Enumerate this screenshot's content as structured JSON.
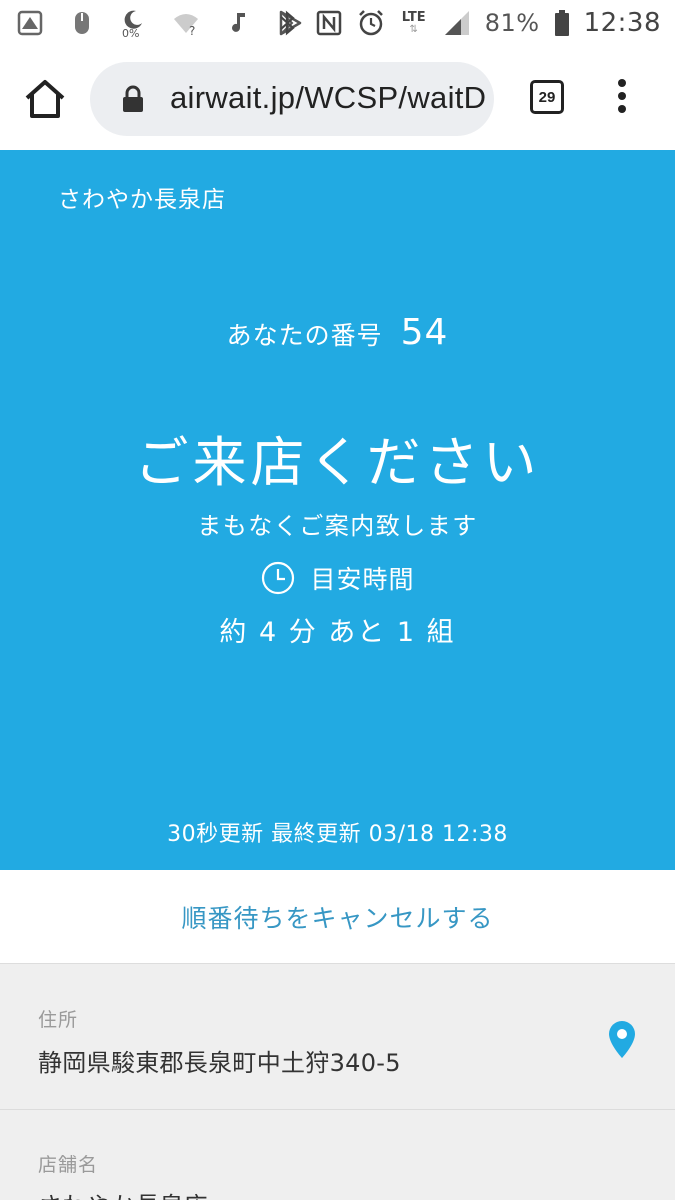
{
  "status_bar": {
    "icons_left": [
      "gallery-icon",
      "mouse-icon",
      "moon-icon",
      "wifi-question-icon",
      "music-note-icon",
      "play-store-icon"
    ],
    "data_saver_label": "0%",
    "icons_right": [
      "bluetooth-icon",
      "nfc-icon",
      "alarm-icon",
      "lte-icon",
      "signal-icon",
      "battery-icon"
    ],
    "lte_label": "LTE",
    "battery_percent": "81%",
    "time": "12:38"
  },
  "browser": {
    "url": "airwait.jp/WCSP/waitD",
    "tab_count": "29"
  },
  "hero": {
    "store_name": "さわやか長泉店",
    "your_number_label": "あなたの番号",
    "your_number": "54",
    "headline": "ご来店ください",
    "subline": "まもなくご案内致します",
    "estimate_label": "目安時間",
    "wait_info": "約 4 分 あと 1 組",
    "update_info": "30秒更新 最終更新 03/18 12:38",
    "background_color": "#22aae2"
  },
  "cancel": {
    "label": "順番待ちをキャンセルする",
    "color": "#3797c4"
  },
  "info": {
    "address_label": "住所",
    "address_value": "静岡県駿東郡長泉町中土狩340-5",
    "store_label": "店舗名",
    "store_value": "さわやか長泉店"
  }
}
